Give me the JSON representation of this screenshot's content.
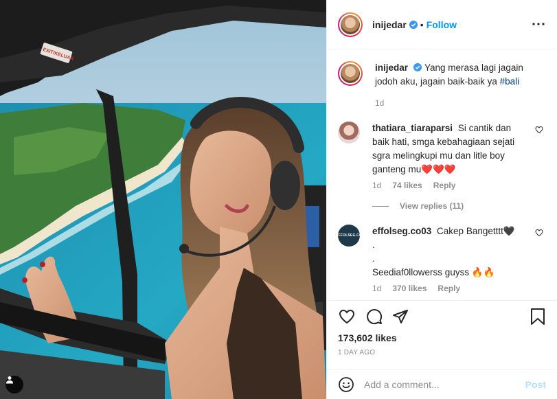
{
  "post": {
    "author": "inijedar",
    "follow_label": "Follow",
    "separator": "•",
    "caption": "Yang merasa lagi jagain jodoh aku, jagain baik-baik ya",
    "caption_hashtag": "#bali",
    "caption_age": "1d",
    "likes": "173,602 likes",
    "date": "1 DAY AGO",
    "photo_sign": "EXIT/KELUAR"
  },
  "comments": [
    {
      "user": "thatiara_tiaraparsi",
      "text": "Si cantik dan baik hati, smga kebahagiaan sejati sgra melingkupi mu dan litle boy ganteng mu❤️❤️❤️",
      "age": "1d",
      "likes": "74 likes",
      "reply_label": "Reply",
      "view_replies": "View replies (11)"
    },
    {
      "user": "effolseg.co03",
      "avatar_text": "EFFOLSEG.CO",
      "line1": "Cakep Bangetttt🖤",
      "line2": ".",
      "line3": ".",
      "line4": "Seediaf0llowerss guyss 🔥🔥",
      "age": "1d",
      "likes": "370 likes",
      "reply_label": "Reply"
    }
  ],
  "add_comment": {
    "placeholder": "Add a comment...",
    "post_label": "Post"
  },
  "icons": [
    "user-tag-icon",
    "verified-icon",
    "more-options-icon",
    "heart-icon",
    "comment-icon",
    "share-icon",
    "bookmark-icon",
    "emoji-icon"
  ],
  "colors": {
    "accent": "#0095f6",
    "hashtag": "#00376b",
    "muted": "#8e8e8e",
    "border": "#efefef"
  }
}
